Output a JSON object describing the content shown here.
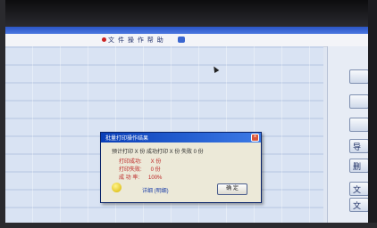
{
  "toolbar": {
    "text": "文 件 操 作 帮 助"
  },
  "side_buttons": [
    "",
    "",
    "",
    "导",
    "删",
    "文",
    "文"
  ],
  "dialog": {
    "title": "批量打印操作结果",
    "summary": "预计打印 X 份  成功打印 X 份  失败 0 份",
    "rows": [
      {
        "label": "打印成功:",
        "value": "X 份"
      },
      {
        "label": "打印失败:",
        "value": "0 份"
      },
      {
        "label": "成 功 率:",
        "value": "100%"
      }
    ],
    "link": "详细 (明细)",
    "ok_label": "确 定",
    "close_glyph": "×"
  },
  "colors": {
    "title_bar": "#2b56c8",
    "dialog_bg": "#ece9d8",
    "accent_red": "#b22222"
  }
}
